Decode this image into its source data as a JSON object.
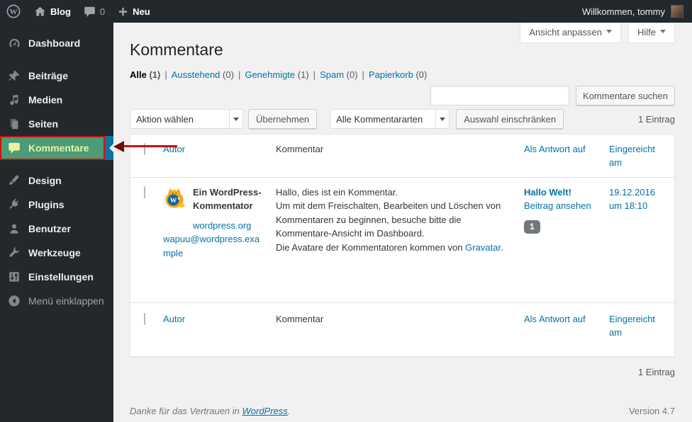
{
  "admin_bar": {
    "site_name": "Blog",
    "comments_count": "0",
    "new_label": "Neu",
    "greeting": "Willkommen, tommy"
  },
  "sidebar": {
    "items": [
      {
        "label": "Dashboard"
      },
      {
        "label": "Beiträge"
      },
      {
        "label": "Medien"
      },
      {
        "label": "Seiten"
      },
      {
        "label": "Kommentare",
        "active": true
      },
      {
        "label": "Design"
      },
      {
        "label": "Plugins"
      },
      {
        "label": "Benutzer"
      },
      {
        "label": "Werkzeuge"
      },
      {
        "label": "Einstellungen"
      }
    ],
    "collapse_label": "Menü einklappen"
  },
  "header": {
    "title": "Kommentare",
    "screen_options_label": "Ansicht anpassen",
    "help_label": "Hilfe"
  },
  "filters": {
    "items": [
      {
        "label": "Alle",
        "count": "(1)",
        "current": true
      },
      {
        "label": "Ausstehend",
        "count": "(0)"
      },
      {
        "label": "Genehmigte",
        "count": "(1)"
      },
      {
        "label": "Spam",
        "count": "(0)"
      },
      {
        "label": "Papierkorb",
        "count": "(0)"
      }
    ],
    "separator": "|"
  },
  "toolbar": {
    "search_placeholder": "",
    "search_button": "Kommentare suchen",
    "bulk_action_select": "Aktion wählen",
    "apply_button": "Übernehmen",
    "type_select": "Alle Kommentararten",
    "filter_button": "Auswahl einschränken",
    "count_text": "1 Eintrag"
  },
  "table": {
    "columns": {
      "author": "Autor",
      "comment": "Kommentar",
      "in_response_to": "Als Antwort auf",
      "submitted_on": "Eingereicht am"
    },
    "row": {
      "author_name": "Ein WordPress-Kommentator",
      "author_url": "wordpress.org",
      "author_email": "wapuu@wordpress.example",
      "comment_p1": "Hallo, dies ist ein Kommentar.",
      "comment_p2": "Um mit dem Freischalten, Bearbeiten und Löschen von Kommentaren zu beginnen, besuche bitte die Kommentare-Ansicht im Dashboard.",
      "comment_p3_prefix": "Die Avatare der Kommentatoren kommen von ",
      "comment_p3_link": "Gravatar",
      "comment_p3_suffix": ".",
      "response_post": "Hallo Welt!",
      "view_post_link": "Beitrag ansehen",
      "comment_count_badge": "1",
      "date": "19.12.2016",
      "time": "um 18:10"
    }
  },
  "footer": {
    "count_text": "1 Eintrag",
    "thanks_prefix": "Danke für das Vertrauen in ",
    "thanks_link": "WordPress",
    "thanks_suffix": ".",
    "version": "Version 4.7"
  },
  "annotation": {
    "highlight_color": "#4d9b77",
    "border_color": "#cc1212",
    "arrow_color": "#c51212",
    "menu_active_blue": "#0d73a4"
  },
  "colors": {
    "accent_link": "#0073aa",
    "admin_dark": "#23282d",
    "content_bg": "#f1f1f1"
  }
}
